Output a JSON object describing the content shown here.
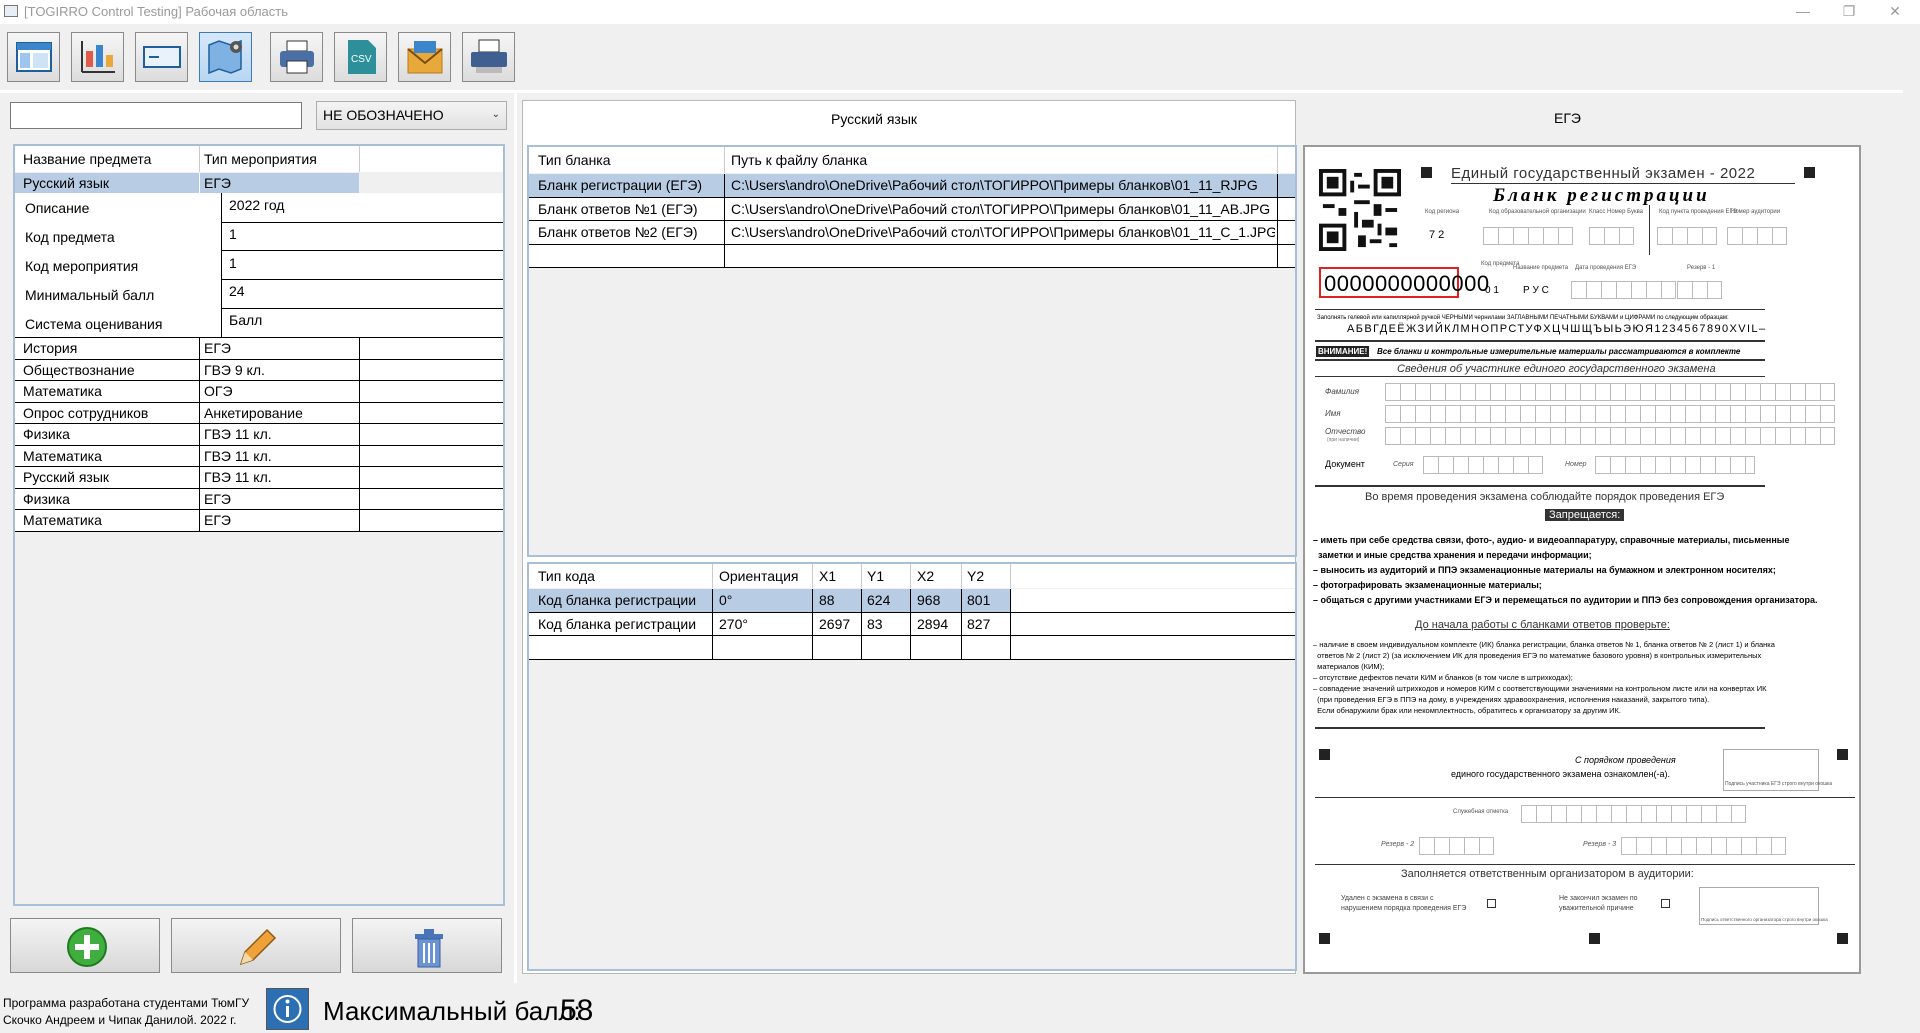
{
  "window": {
    "title": "[TOGIRRO Control Testing] Рабочая область",
    "controls": {
      "minimize": "—",
      "restore": "❐",
      "close": "✕"
    }
  },
  "toolbar": {
    "buttons": [
      {
        "icon": "layout-icon"
      },
      {
        "icon": "chart-settings-icon"
      },
      {
        "icon": "form-card-icon"
      },
      {
        "icon": "map-settings-icon"
      },
      {
        "icon": "printer-icon"
      },
      {
        "icon": "csv-export-icon",
        "label": "CSV"
      },
      {
        "icon": "mail-icon"
      },
      {
        "icon": "scanner-icon"
      }
    ]
  },
  "left": {
    "search": {
      "value": ""
    },
    "filter": {
      "value": "НЕ ОБОЗНАЧЕНО"
    },
    "grid": {
      "columns": [
        "Название предмета",
        "Тип мероприятия"
      ],
      "selected": {
        "subject": "Русский язык",
        "event": "ЕГЭ"
      },
      "details": [
        {
          "label": "Описание",
          "value": "2022 год"
        },
        {
          "label": "Код предмета",
          "value": "1"
        },
        {
          "label": "Код мероприятия",
          "value": "1"
        },
        {
          "label": "Минимальный балл",
          "value": "24"
        },
        {
          "label": "Система оценивания",
          "value": "Балл"
        }
      ],
      "rows": [
        {
          "subject": "История",
          "event": "ЕГЭ"
        },
        {
          "subject": "Обществознание",
          "event": "ГВЭ 9 кл."
        },
        {
          "subject": "Математика",
          "event": "ОГЭ"
        },
        {
          "subject": "Опрос сотрудников",
          "event": "Анкетирование"
        },
        {
          "subject": "Физика",
          "event": "ГВЭ 11 кл."
        },
        {
          "subject": "Математика",
          "event": "ГВЭ 11 кл."
        },
        {
          "subject": "Русский язык",
          "event": "ГВЭ 11 кл."
        },
        {
          "subject": "Физика",
          "event": "ЕГЭ"
        },
        {
          "subject": "Математика",
          "event": "ЕГЭ"
        }
      ]
    },
    "buttons": {
      "add": "add-icon",
      "edit": "pencil-icon",
      "delete": "trash-icon"
    }
  },
  "right": {
    "subject_title": "Русский язык",
    "event_title": "ЕГЭ",
    "blanks": {
      "columns": [
        "Тип бланка",
        "Путь к файлу бланка"
      ],
      "rows": [
        {
          "type": "Бланк регистрации (ЕГЭ)",
          "path": "C:\\Users\\andro\\OneDrive\\Рабочий стол\\ТОГИРРО\\Примеры бланков\\01_11_RJPG"
        },
        {
          "type": "Бланк ответов №1 (ЕГЭ)",
          "path": "C:\\Users\\andro\\OneDrive\\Рабочий стол\\ТОГИРРО\\Примеры бланков\\01_11_AB.JPG"
        },
        {
          "type": "Бланк ответов №2 (ЕГЭ)",
          "path": "C:\\Users\\andro\\OneDrive\\Рабочий стол\\ТОГИРРО\\Примеры бланков\\01_11_C_1.JPG"
        }
      ]
    },
    "codes": {
      "columns": [
        "Тип кода",
        "Ориентация",
        "X1",
        "Y1",
        "X2",
        "Y2"
      ],
      "rows": [
        {
          "type": "Код бланка регистрации",
          "orientation": "0°",
          "x1": "88",
          "y1": "624",
          "x2": "968",
          "y2": "801"
        },
        {
          "type": "Код бланка регистрации",
          "orientation": "270°",
          "x1": "2697",
          "y1": "83",
          "x2": "2894",
          "y2": "827"
        }
      ]
    },
    "form_preview": {
      "header": "Единый государственный экзамен - 2022",
      "subheader": "Бланк регистрации",
      "barcode": "0000000000000",
      "region_label": "Код региона",
      "region_value": "7 2",
      "org_label": "Код образовательной организации",
      "class_label": "Класс Номер Буква",
      "ppe_label": "Код пункта проведения ЕГЭ",
      "auditorium_label": "Номер аудитории",
      "subject_code_label": "Код предмета",
      "subject_code": "0 1",
      "subject_name_label": "Название предмета",
      "subject_name": "Р У С",
      "date_label": "Дата проведения ЕГЭ",
      "reserve1": "Резерв - 1",
      "fill_instruction": "Заполнять гелевой или капиллярной ручкой ЧЕРНЫМИ чернилами ЗАГЛАВНЫМИ ПЕЧАТНЫМИ БУКВАМИ и ЦИФРАМИ по следующим образцам:",
      "alphabet": "АБВГДЕЁЖЗИЙКЛМНОПРСТУФХЦЧШЩЪЫЬЭЮЯ1234567890XVIL–",
      "attention_label": "ВНИМАНИЕ!",
      "attention_text": "Все бланки и контрольные измерительные материалы рассматриваются в комплекте",
      "participant_title": "Сведения об участнике единого государственного экзамена",
      "surname": "Фамилия",
      "name": "Имя",
      "patronymic": "Отчество",
      "patronymic_note": "(при наличии)",
      "document": "Документ",
      "series": "Серия",
      "number": "Номер",
      "order_title": "Во время проведения экзамена соблюдайте порядок проведения ЕГЭ",
      "forbidden": "Запрещается:",
      "rules": [
        "– иметь при себе средства связи, фото-, аудио- и видеоаппаратуру, справочные материалы, письменные",
        "  заметки и иные средства хранения и передачи информации;",
        "– выносить из аудиторий и ППЭ экзаменационные материалы на бумажном и электронном носителях;",
        "– фотографировать экзаменационные материалы;",
        "– общаться с другими участниками ЕГЭ и перемещаться по аудитории и ППЭ без сопровождения организатора."
      ],
      "check_title": "До начала работы с бланками ответов проверьте:",
      "checks": [
        "– наличие в своем индивидуальном комплекте (ИК) бланка регистрации, бланка ответов № 1, бланка ответов № 2 (лист 1) и бланка",
        "  ответов № 2 (лист 2) (за исключением ИК для проведения ЕГЭ по математике базового уровня) в контрольных измерительных",
        "  материалов (КИМ);",
        "– отсутствие дефектов печати КИМ и бланков (в том числе в штрихкодах);",
        "– совпадение значений штрихкодов и номеров КИМ с соответствующими значениями на контрольном листе или на конвертах ИК",
        "  (при проведения ЕГЭ в ППЭ на дому, в учреждениях здравоохранения, исполнения наказаний, закрытого типа).",
        "  Если обнаружили брак или некомплектность, обратитесь к организатору за другим ИК."
      ],
      "acquainted": "С порядком проведения",
      "acquainted2": "единого государственного экзамена ознакомлен(-а).",
      "signature_note": "Подпись участника ЕГЭ строго внутри окошка",
      "service_mark": "Служебная отметка",
      "reserve2": "Резерв - 2",
      "reserve3": "Резерв - 3",
      "organizer_title": "Заполняется ответственным организатором в аудитории:",
      "removed": "Удален с экзамена в связи с",
      "removed2": "нарушением порядка проведения ЕГЭ",
      "not_finished": "Не закончил экзамен по",
      "not_finished2": "уважительной причине",
      "organizer_signature": "Подпись ответственного организатора строго внутри окошка"
    }
  },
  "status": {
    "developer_line1": "Программа разработана студентами ТюмГУ",
    "developer_line2": "Скочко Андреем и Чипак Данилой. 2022 г.",
    "info_icon": "info-icon",
    "max_score_label": "Максимальный балл:",
    "max_score_value": "58"
  }
}
